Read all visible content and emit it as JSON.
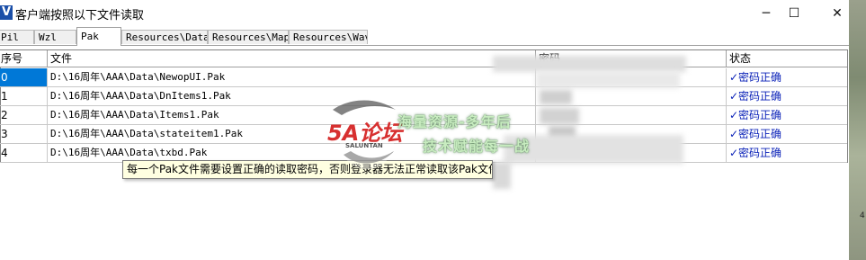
{
  "window": {
    "app_icon_glyph": "V",
    "title": "客户端按照以下文件读取",
    "minimize": "─",
    "maximize": "☐",
    "close": "✕"
  },
  "tabs": [
    {
      "label": "Pil",
      "active": false
    },
    {
      "label": "Wzl",
      "active": false
    },
    {
      "label": "Pak",
      "active": true
    },
    {
      "label": "Resources\\Data",
      "active": false
    },
    {
      "label": "Resources\\Map",
      "active": false
    },
    {
      "label": "Resources\\Wav",
      "active": false
    }
  ],
  "table": {
    "headers": {
      "index": "序号",
      "file": "文件",
      "password": "密码",
      "status": "状态"
    },
    "rows": [
      {
        "index": "0",
        "file": "D:\\16周年\\AAA\\Data\\NewopUI.Pak",
        "status": "✓密码正确"
      },
      {
        "index": "1",
        "file": "D:\\16周年\\AAA\\Data\\DnItems1.Pak",
        "status": "✓密码正确"
      },
      {
        "index": "2",
        "file": "D:\\16周年\\AAA\\Data\\Items1.Pak",
        "status": "✓密码正确"
      },
      {
        "index": "3",
        "file": "D:\\16周年\\AAA\\Data\\stateitem1.Pak",
        "status": "✓密码正确"
      },
      {
        "index": "4",
        "file": "D:\\16周年\\AAA\\Data\\txbd.Pak",
        "status": "✓密码正确"
      }
    ]
  },
  "tooltip": "每一个Pak文件需要设置正确的读取密码，否则登录器无法正常读取该Pak文件",
  "watermark": {
    "logo_text": "5A论坛",
    "logo_sub": "SALUNTAN",
    "line1": "海量资源-多年后",
    "line2": "技术赋能每一战"
  },
  "edge_text": "4"
}
